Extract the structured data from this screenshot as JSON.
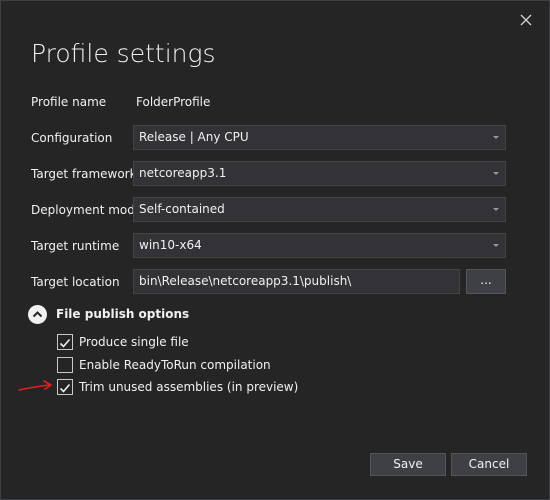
{
  "dialog": {
    "title": "Profile settings",
    "close_icon": "close-icon"
  },
  "fields": {
    "profile_name": {
      "label": "Profile name",
      "value": "FolderProfile"
    },
    "configuration": {
      "label": "Configuration",
      "value": "Release | Any CPU"
    },
    "target_framework": {
      "label": "Target framework",
      "value": "netcoreapp3.1"
    },
    "deployment_mode": {
      "label": "Deployment mode",
      "value": "Self-contained"
    },
    "target_runtime": {
      "label": "Target runtime",
      "value": "win10-x64"
    },
    "target_location": {
      "label": "Target location",
      "value": "bin\\Release\\netcoreapp3.1\\publish\\",
      "browse_label": "..."
    }
  },
  "publish_options": {
    "label": "File publish options",
    "expanded": true,
    "options": [
      {
        "label": "Produce single file",
        "checked": true
      },
      {
        "label": "Enable ReadyToRun compilation",
        "checked": false
      },
      {
        "label": "Trim unused assemblies (in preview)",
        "checked": true
      }
    ]
  },
  "buttons": {
    "save": "Save",
    "cancel": "Cancel"
  },
  "colors": {
    "background": "#252526",
    "input_background": "#333337",
    "button_background": "#3f3f46",
    "text": "#f1f1f1",
    "annotation": "#e02020"
  }
}
